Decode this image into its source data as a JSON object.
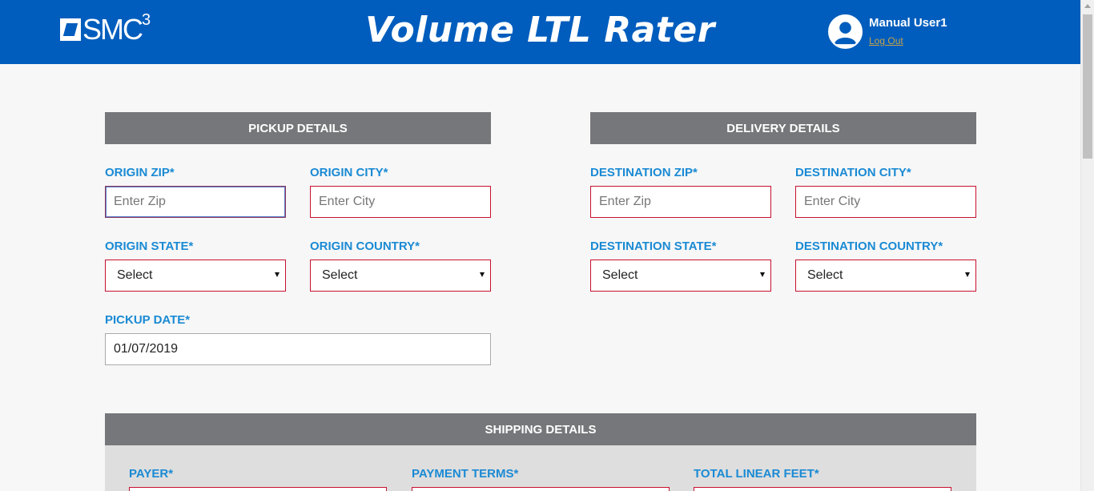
{
  "header": {
    "logo_text": "SMC",
    "logo_sup": "3",
    "title": "Volume LTL Rater",
    "user_name": "Manual User1",
    "logout_label": "Log Out"
  },
  "pickup": {
    "section_title": "PICKUP DETAILS",
    "origin_zip_label": "ORIGIN ZIP*",
    "origin_zip_placeholder": "Enter Zip",
    "origin_city_label": "ORIGIN CITY*",
    "origin_city_placeholder": "Enter City",
    "origin_state_label": "ORIGIN STATE*",
    "origin_state_value": "Select",
    "origin_country_label": "ORIGIN COUNTRY*",
    "origin_country_value": "Select",
    "pickup_date_label": "PICKUP DATE*",
    "pickup_date_value": "01/07/2019"
  },
  "delivery": {
    "section_title": "DELIVERY DETAILS",
    "dest_zip_label": "DESTINATION ZIP*",
    "dest_zip_placeholder": "Enter Zip",
    "dest_city_label": "DESTINATION CITY*",
    "dest_city_placeholder": "Enter City",
    "dest_state_label": "DESTINATION STATE*",
    "dest_state_value": "Select",
    "dest_country_label": "DESTINATION COUNTRY*",
    "dest_country_value": "Select"
  },
  "shipping": {
    "section_title": "SHIPPING DETAILS",
    "payer_label": "PAYER*",
    "payment_terms_label": "PAYMENT TERMS*",
    "total_linear_feet_label": "TOTAL LINEAR FEET*"
  },
  "colors": {
    "header_bg": "#005dbd",
    "section_bar": "#76777a",
    "label": "#1a8ad4",
    "required_border": "#c8102e"
  }
}
